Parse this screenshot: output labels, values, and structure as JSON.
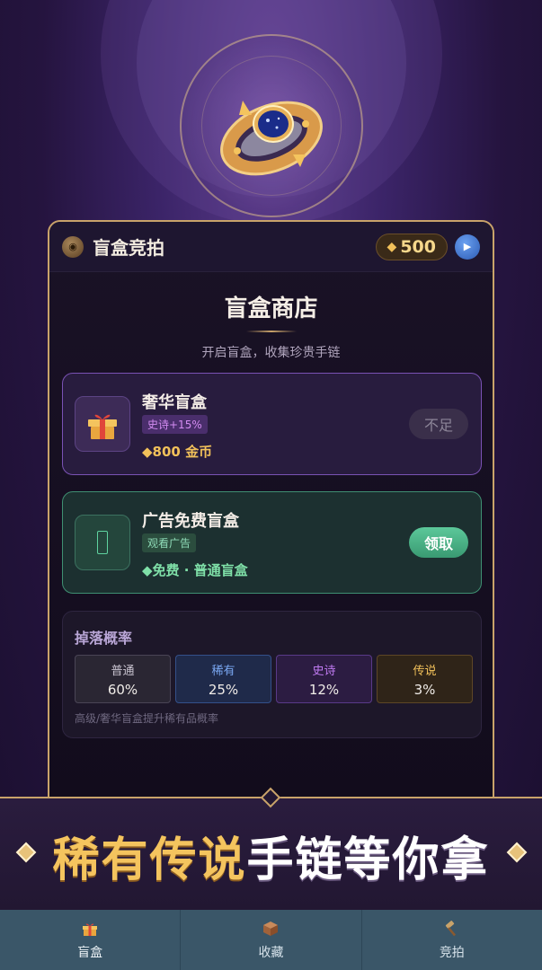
{
  "header": {
    "title": "盲盒竞拍",
    "gem_amount": "500",
    "coin_icon": "coin-icon",
    "play_icon": "play-icon"
  },
  "shop": {
    "title": "盲盒商店",
    "subtitle": "开启盲盒，收集珍贵手链"
  },
  "cards": {
    "luxury": {
      "name": "奢华盲盒",
      "tag": "史诗+15%",
      "price": "◆800 金币",
      "button": "不足",
      "icon": "gift-icon"
    },
    "ad": {
      "name": "广告免费盲盒",
      "tag": "观看广告",
      "price": "◆免费 · 普通盲盒",
      "button": "领取",
      "icon": "phone-icon"
    }
  },
  "drop_rates": {
    "title": "掉落概率",
    "items": [
      {
        "name": "普通",
        "value": "60%"
      },
      {
        "name": "稀有",
        "value": "25%"
      },
      {
        "name": "史诗",
        "value": "12%"
      },
      {
        "name": "传说",
        "value": "3%"
      }
    ],
    "note": "高级/奢华盲盒提升稀有品概率"
  },
  "banner": {
    "gold_text": "稀有传说",
    "white_text": "手链等你拿"
  },
  "tabs": [
    {
      "label": "盲盒",
      "icon": "gift-icon"
    },
    {
      "label": "收藏",
      "icon": "box-icon"
    },
    {
      "label": "竞拍",
      "icon": "gavel-icon"
    }
  ],
  "colors": {
    "gold": "#c9a36a",
    "purple_border": "#7a52b4",
    "green_border": "#3f8f72",
    "tabbar": "#3a5668"
  }
}
